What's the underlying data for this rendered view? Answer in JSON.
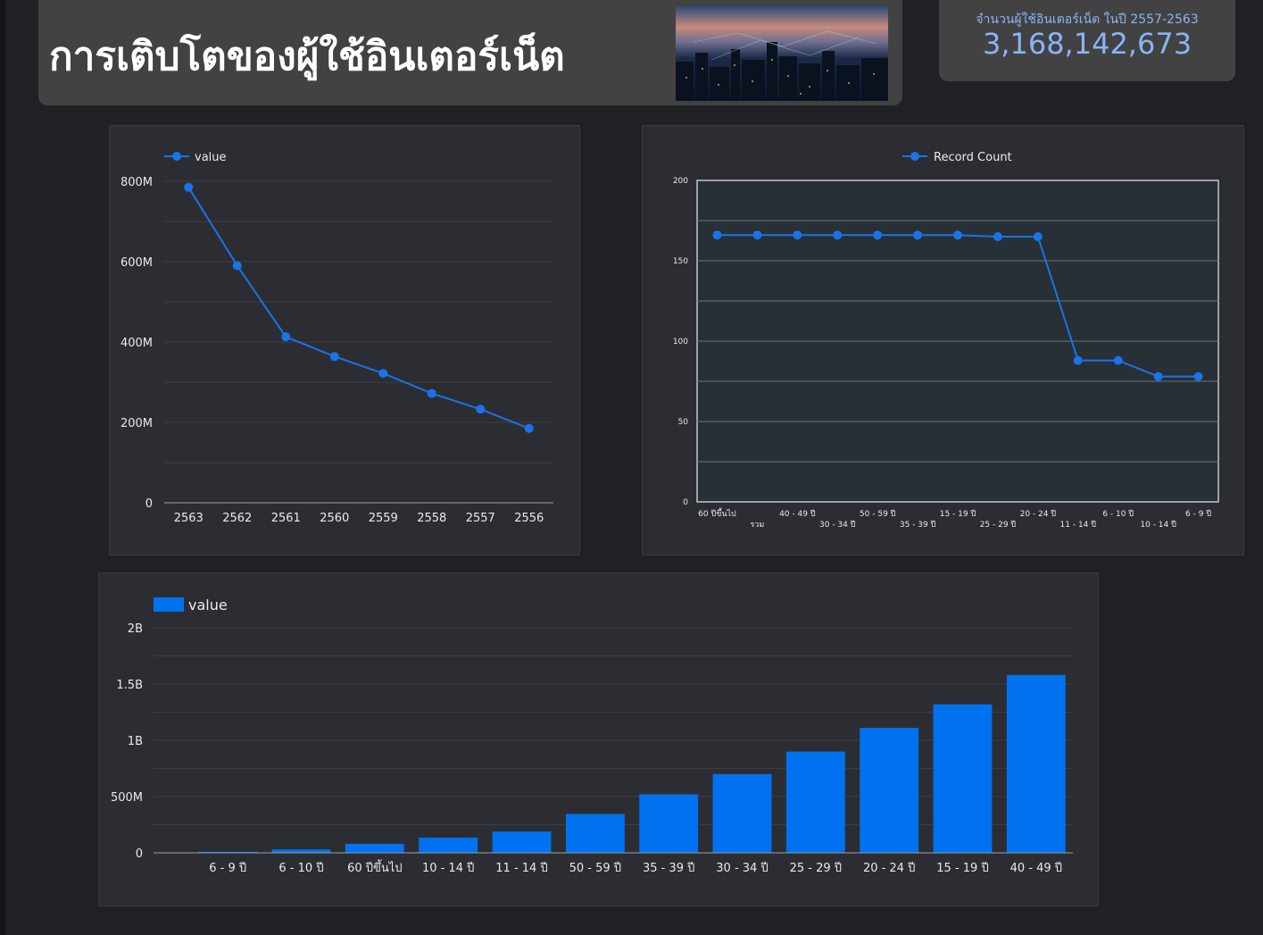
{
  "header": {
    "title": "การเติบโตของผู้ใช้อินเตอร์เน็ต",
    "image_icon": "city-network-photo"
  },
  "scorecard": {
    "label": "จำนวนผู้ใช้อินเตอร์เน็ต ในปี 2557-2563",
    "value": "3,168,142,673"
  },
  "colors": {
    "accent": "#1a73e8",
    "bar": "#0072f0",
    "scorecard_text": "#8ab4f8",
    "panel_bg": "#2c2d33",
    "page_bg": "#202124"
  },
  "chart_data": [
    {
      "type": "line",
      "categories": [
        "2563",
        "2562",
        "2561",
        "2560",
        "2559",
        "2558",
        "2557",
        "2556"
      ],
      "series": [
        {
          "name": "value",
          "values": [
            785000000,
            590000000,
            413000000,
            364000000,
            322000000,
            272000000,
            233000000,
            185000000
          ]
        }
      ],
      "yticks": [
        "0",
        "200M",
        "400M",
        "600M",
        "800M"
      ],
      "ylim": [
        0,
        800000000
      ],
      "grid": true,
      "legend": "top-left"
    },
    {
      "type": "line",
      "categories": [
        "60 ปีขึ้นไป",
        "รวม",
        "40 - 49 ปี",
        "30 - 34 ปี",
        "50 - 59 ปี",
        "35 - 39 ปี",
        "15 - 19 ปี",
        "25 - 29 ปี",
        "20 - 24 ปี",
        "11 - 14 ปี",
        "6 - 10 ปี",
        "10 - 14 ปี",
        "6 - 9 ปี"
      ],
      "series": [
        {
          "name": "Record Count",
          "values": [
            166,
            166,
            166,
            166,
            166,
            166,
            166,
            165,
            165,
            88,
            88,
            78,
            78
          ]
        }
      ],
      "yticks": [
        "0",
        "50",
        "100",
        "150",
        "200"
      ],
      "ylim": [
        0,
        200
      ],
      "grid": true,
      "legend": "top-center"
    },
    {
      "type": "bar",
      "categories": [
        "6 - 9 ปี",
        "6 - 10 ปี",
        "60 ปีขึ้นไป",
        "10 - 14 ปี",
        "11 - 14 ปี",
        "50 - 59 ปี",
        "35 - 39 ปี",
        "30 - 34 ปี",
        "25 - 29 ปี",
        "20 - 24 ปี",
        "15 - 19 ปี",
        "40 - 49 ปี"
      ],
      "series": [
        {
          "name": "value",
          "values": [
            10000000,
            30000000,
            80000000,
            135000000,
            190000000,
            345000000,
            520000000,
            700000000,
            900000000,
            1110000000,
            1320000000,
            1580000000
          ]
        }
      ],
      "yticks": [
        "0",
        "500M",
        "1B",
        "1.5B",
        "2B"
      ],
      "ylim": [
        0,
        2000000000
      ],
      "grid": true,
      "legend": "top-left"
    }
  ]
}
